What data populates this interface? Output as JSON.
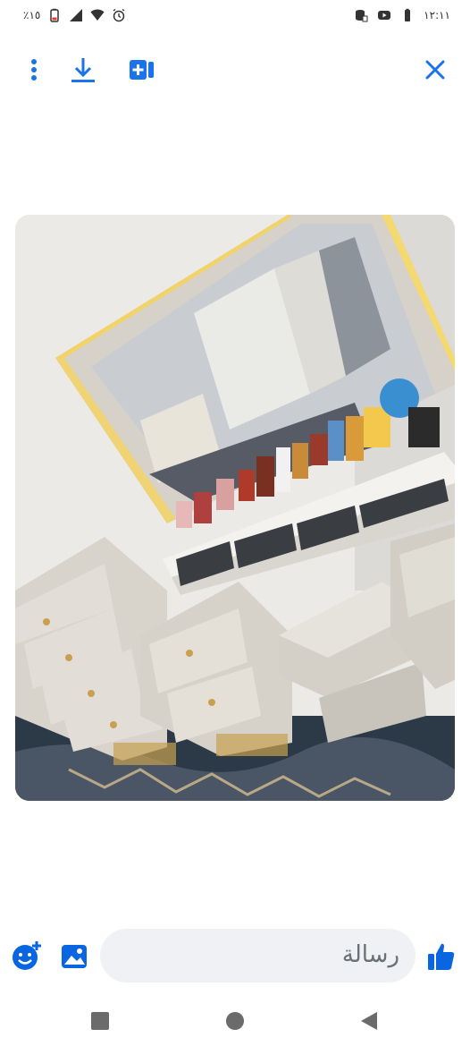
{
  "status_bar": {
    "battery_percent": "٪١٥",
    "time": "١٢:١١"
  },
  "composer": {
    "placeholder": "رسالة"
  },
  "colors": {
    "accent": "#1a73e8",
    "messenger_blue": "#0a66e0",
    "background": "#ffffff"
  },
  "icons": {
    "more": "more-vertical-icon",
    "download": "download-icon",
    "add_to_album": "add-photo-icon",
    "close": "close-icon",
    "emoji": "emoji-add-icon",
    "gallery": "image-icon",
    "like": "thumbs-up-icon"
  }
}
